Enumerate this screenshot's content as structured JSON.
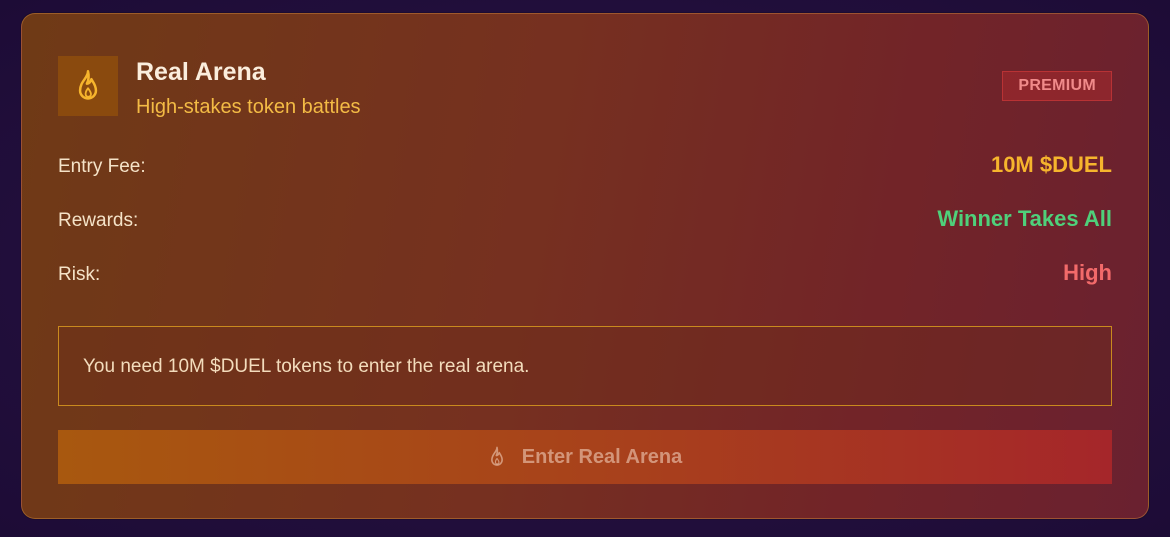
{
  "arena": {
    "title": "Real Arena",
    "subtitle": "High-stakes token battles",
    "badge": "PREMIUM",
    "icon": "flame-icon"
  },
  "details": [
    {
      "label": "Entry Fee:",
      "value": "10M $DUEL",
      "color": "#f6b52d"
    },
    {
      "label": "Rewards:",
      "value": "Winner Takes All",
      "color": "#4fd07a"
    },
    {
      "label": "Risk:",
      "value": "High",
      "color": "#f26a6a"
    }
  ],
  "notice": {
    "text": "You need 10M $DUEL tokens to enter the real arena."
  },
  "button": {
    "label": "Enter Real Arena",
    "icon": "flame-icon",
    "disabled": true
  },
  "colors": {
    "accent": "#f6b52d",
    "success": "#4fd07a",
    "danger": "#f26a6a"
  }
}
